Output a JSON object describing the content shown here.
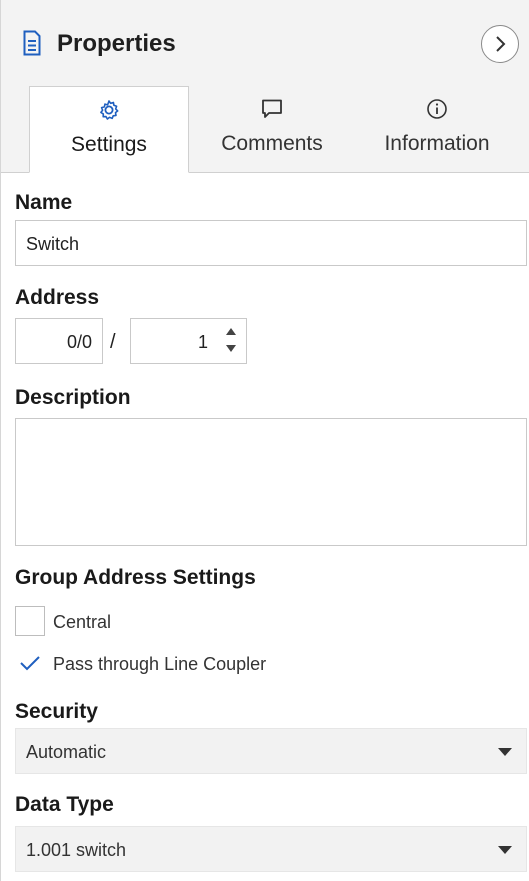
{
  "header": {
    "title": "Properties",
    "icon": "document-icon",
    "collapse_icon": "chevron-right-icon"
  },
  "tabs": [
    {
      "label": "Settings",
      "icon": "gear-icon",
      "active": true
    },
    {
      "label": "Comments",
      "icon": "comment-icon",
      "active": false
    },
    {
      "label": "Information",
      "icon": "info-icon",
      "active": false
    }
  ],
  "name": {
    "label": "Name",
    "value": "Switch"
  },
  "address": {
    "label": "Address",
    "main": "0/0",
    "separator": "/",
    "sub": "1"
  },
  "description": {
    "label": "Description",
    "value": ""
  },
  "group_settings": {
    "label": "Group Address Settings",
    "central": {
      "label": "Central",
      "checked": false
    },
    "pass_through": {
      "label": "Pass through Line Coupler",
      "checked": true
    }
  },
  "security": {
    "label": "Security",
    "value": "Automatic"
  },
  "data_type": {
    "label": "Data Type",
    "value": "1.001 switch"
  },
  "colors": {
    "accent": "#1f5fbf",
    "border": "#c9c9c9",
    "select_bg": "#f2f2f2"
  }
}
